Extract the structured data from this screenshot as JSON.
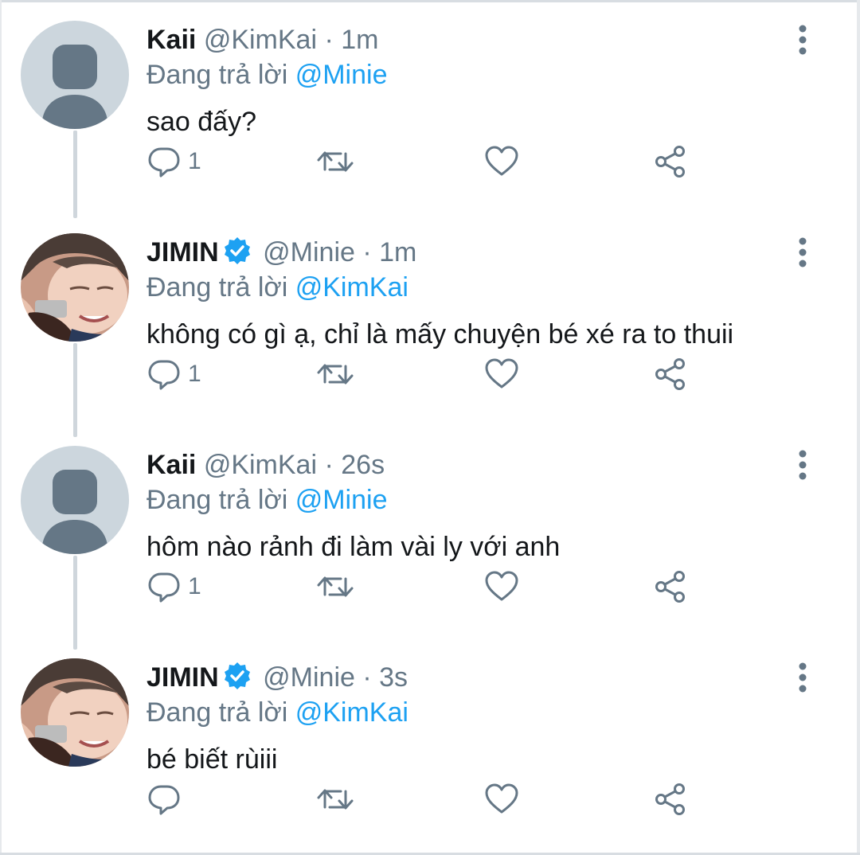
{
  "colors": {
    "accent": "#1da1f2",
    "muted": "#657786",
    "text": "#14171a",
    "thread_line": "#cfd6dc"
  },
  "tweets": [
    {
      "name": "Kaii",
      "verified": false,
      "handle": "@KimKai",
      "separator": "·",
      "time": "1m",
      "reply_prefix": "Đang trả lời",
      "reply_to": "@Minie",
      "text": "sao đấy?",
      "reply_count": "1",
      "avatar": "default-avatar"
    },
    {
      "name": "JIMIN",
      "verified": true,
      "handle": "@Minie",
      "separator": "·",
      "time": "1m",
      "reply_prefix": "Đang trả lời",
      "reply_to": "@KimKai",
      "text": "không có gì ạ, chỉ là mấy chuyện bé xé ra to thuii",
      "reply_count": "1",
      "avatar": "photo-avatar"
    },
    {
      "name": "Kaii",
      "verified": false,
      "handle": "@KimKai",
      "separator": "·",
      "time": "26s",
      "reply_prefix": "Đang trả lời",
      "reply_to": "@Minie",
      "text": "hôm nào rảnh đi làm vài ly với anh",
      "reply_count": "1",
      "avatar": "default-avatar"
    },
    {
      "name": "JIMIN",
      "verified": true,
      "handle": "@Minie",
      "separator": "·",
      "time": "3s",
      "reply_prefix": "Đang trả lời",
      "reply_to": "@KimKai",
      "text": "bé biết rùiii",
      "reply_count": "",
      "avatar": "photo-avatar"
    }
  ],
  "icons": {
    "reply": "reply-icon",
    "retweet": "retweet-icon",
    "like": "heart-icon",
    "share": "share-icon",
    "more": "more-options-icon",
    "verified": "verified-badge-icon"
  }
}
